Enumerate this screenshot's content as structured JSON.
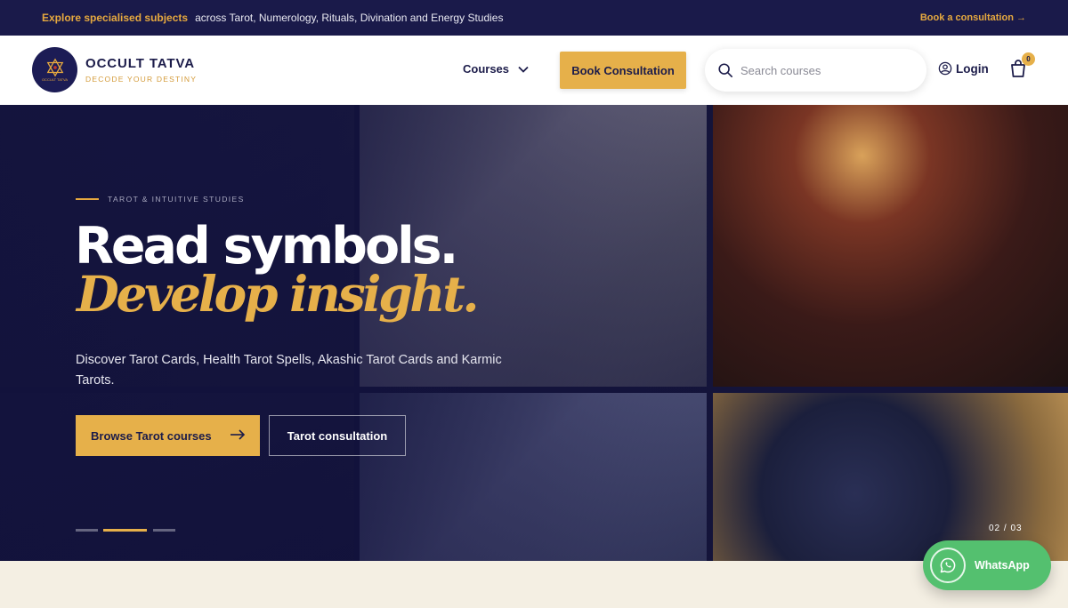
{
  "announcement": {
    "highlight": "Explore specialised subjects",
    "message": "across Tarot, Numerology, Rituals, Divination and Energy Studies",
    "cta": "Book a consultation →"
  },
  "header": {
    "logo_text": "OCCULT TATVA",
    "brand_name": "OCCULT TATVA",
    "tagline": "DECODE YOUR DESTINY",
    "nav_courses": "Courses",
    "book_button": "Book Consultation",
    "search_placeholder": "Search courses",
    "login_label": "Login",
    "cart_count": "0"
  },
  "hero": {
    "eyebrow": "TAROT & INTUITIVE STUDIES",
    "headline": "Read symbols.",
    "headline_accent": "Develop insight.",
    "description": "Discover Tarot Cards, Health Tarot Spells, Akashic Tarot Cards and Karmic Tarots.",
    "primary_button": "Browse Tarot courses",
    "secondary_button": "Tarot consultation",
    "slide_counter": "02 / 03",
    "active_slide": 2,
    "total_slides": 3
  },
  "whatsapp": {
    "label": "WhatsApp"
  },
  "colors": {
    "navy": "#1a1a4a",
    "gold": "#e6b04a",
    "whatsapp_green": "#54c06f",
    "cream": "#f4efe3"
  },
  "icons": [
    "chevron-down-icon",
    "search-icon",
    "user-circle-icon",
    "cart-icon",
    "arrow-right-icon",
    "whatsapp-icon",
    "star-of-david-icon"
  ]
}
